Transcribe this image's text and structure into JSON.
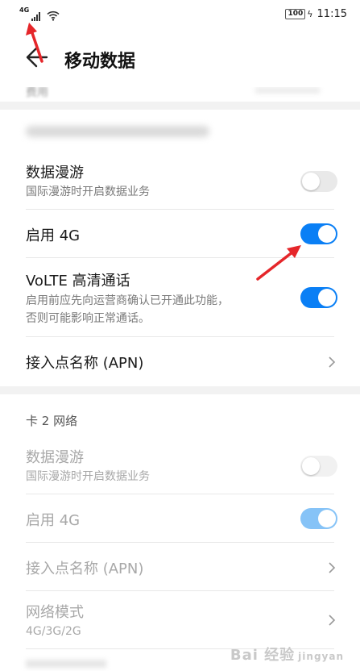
{
  "status_bar": {
    "network_type": "4G",
    "battery": "100",
    "time": "11:15"
  },
  "header": {
    "title": "移动数据"
  },
  "peek": {
    "text": "费用"
  },
  "sim1": {
    "rows": [
      {
        "title": "数据漫游",
        "subtitle": "国际漫游时开启数据业务",
        "enabled": false
      },
      {
        "title": "启用 4G",
        "enabled": true
      },
      {
        "title": "VoLTE 高清通话",
        "subtitle_line1": "启用前应先向运营商确认已开通此功能，",
        "subtitle_line2": "否则可能影响正常通话。",
        "enabled": true
      },
      {
        "title": "接入点名称 (APN)"
      }
    ]
  },
  "sim2": {
    "section_title": "卡 2 网络",
    "rows": [
      {
        "title": "数据漫游",
        "subtitle": "国际漫游时开启数据业务",
        "enabled": false
      },
      {
        "title": "启用 4G",
        "enabled": true
      },
      {
        "title": "接入点名称 (APN)"
      },
      {
        "title": "网络模式",
        "subtitle": "4G/3G/2G"
      }
    ]
  },
  "watermark": {
    "text": "Bai 经验",
    "sub": "jingyan"
  },
  "colors": {
    "toggle_on": "#0a7ff5",
    "toggle_on_disabled": "#86c3f7",
    "toggle_off": "#e9e9e9",
    "annotation_arrow": "#e5262a"
  }
}
